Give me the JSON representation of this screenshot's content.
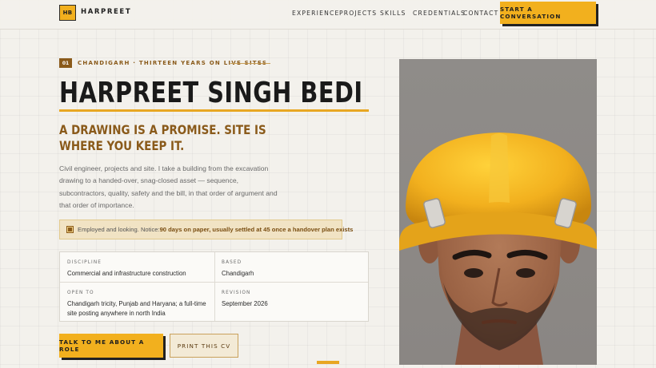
{
  "brand": {
    "initials": "HB",
    "name": "HARPREET"
  },
  "nav": {
    "items": [
      {
        "label": "EXPERIENCE"
      },
      {
        "label": "PROJECTS"
      },
      {
        "label": "SKILLS"
      },
      {
        "label": "CREDENTIALS"
      },
      {
        "label": "CONTACT"
      }
    ],
    "cta_label": "START A CONVERSATION"
  },
  "hero": {
    "eyebrow_number": "01",
    "eyebrow_text": "CHANDIGARH · THIRTEEN YEARS ON LIVE SITES",
    "name": "HARPREET SINGH BEDI",
    "tagline": "A DRAWING IS A PROMISE. SITE IS WHERE YOU KEEP IT.",
    "intro": "Civil engineer, projects and site. I take a building from the excavation drawing to a handed-over, snag-closed asset — sequence, subcontractors, quality, safety and the bill, in that order of argument and that order of importance.",
    "notice": {
      "prefix": "Employed and looking. Notice: ",
      "emphasis": "90 days on paper, usually settled at 45 once a handover plan exists"
    },
    "facts": {
      "discipline": {
        "label": "DISCIPLINE",
        "value": "Commercial and infrastructure construction"
      },
      "based": {
        "label": "BASED",
        "value": "Chandigarh"
      },
      "open_to": {
        "label": "OPEN TO",
        "value": "Chandigarh tricity, Punjab and Haryana; a full-time site posting anywhere in north India"
      },
      "revision": {
        "label": "REVISION",
        "value": "September 2026"
      }
    },
    "primary_button": "TALK TO ME ABOUT A ROLE",
    "secondary_button": "PRINT THIS CV"
  },
  "portrait": {
    "icon": "portrait-photo",
    "subject": "engineer-in-yellow-hard-hat"
  },
  "colors": {
    "accent": "#f2b01e",
    "accent_rule": "#e8a723",
    "brown": "#8a5a1a",
    "background": "#f3f1ec",
    "ink": "#1a1a1a"
  }
}
